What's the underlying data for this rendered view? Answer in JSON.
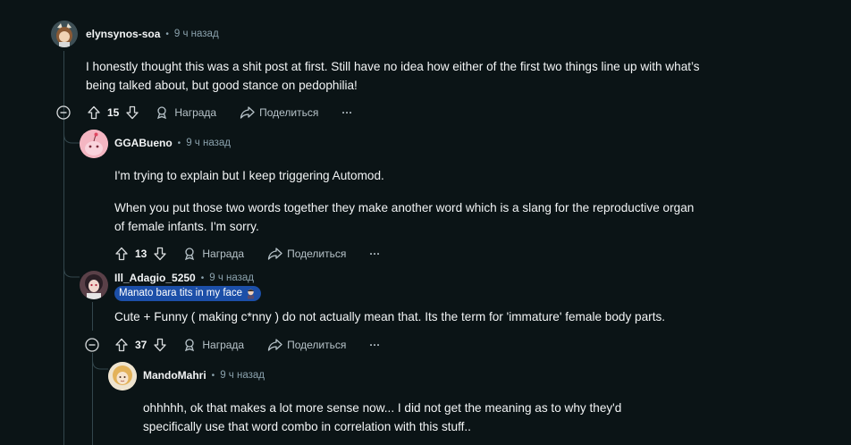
{
  "comments": [
    {
      "username": "elynsynos-soa",
      "time": "9 ч назад",
      "body": [
        "I honestly thought this was a shit post at first. Still have no idea how either of the first two things line up with what’s being talked about, but good stance on pedophilia!"
      ],
      "votes": "15",
      "award_label": "Награда",
      "share_label": "Поделиться",
      "more_label": "···"
    },
    {
      "username": "GGABueno",
      "time": "9 ч назад",
      "body": [
        "I'm trying to explain but I keep triggering Automod.",
        "When you put those two words together they make another word which is a slang for the reproductive organ of female infants. I'm sorry."
      ],
      "votes": "13",
      "award_label": "Награда",
      "share_label": "Поделиться",
      "more_label": "···"
    },
    {
      "username": "Ill_Adagio_5250",
      "time": "9 ч назад",
      "flair": "Manato bara tits in my face",
      "body": [
        "Cute + Funny ( making c*nny ) do not actually mean that. Its the term for 'immature' female body parts."
      ],
      "votes": "37",
      "award_label": "Награда",
      "share_label": "Поделиться",
      "more_label": "···"
    },
    {
      "username": "MandoMahri",
      "time": "9 ч назад",
      "body": [
        "ohhhhh, ok that makes a lot more sense now... I did not get the meaning as to why they'd specifically use that word combo in correlation with this stuff.."
      ]
    }
  ],
  "separator": "•",
  "colors": {
    "background": "#0b1416",
    "thread_line": "#33464c",
    "flair_bg": "#1c4fa8"
  }
}
